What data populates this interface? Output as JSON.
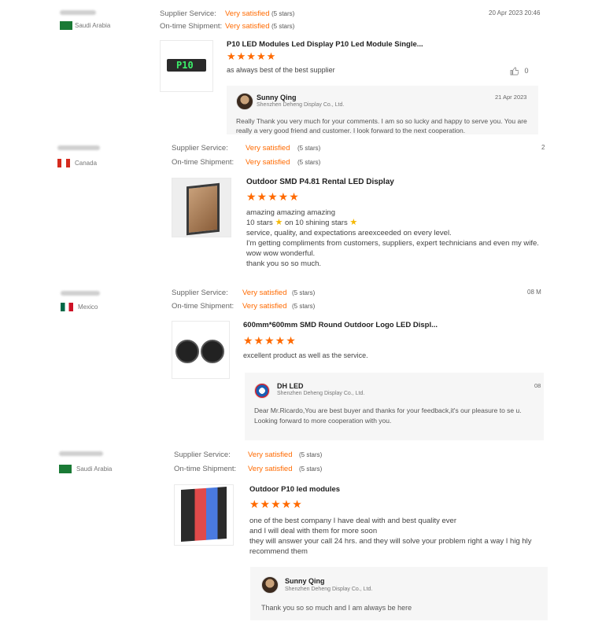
{
  "labels": {
    "supplier_service": "Supplier Service:",
    "ontime_shipment": "On-time Shipment:",
    "very_satisfied": "Very satisfied",
    "five_stars": "(5 stars)"
  },
  "colors": {
    "accent": "#ff6a00",
    "star_icon": "#f5b800"
  },
  "reviews": [
    {
      "country": "Saudi Arabia",
      "date": "20 Apr 2023 20:46",
      "product_title": "P10 LED Modules Led Display P10 Led Module Single...",
      "thumb_text": "P10",
      "rating_stars": 5,
      "text": [
        "as always best of the best supplier"
      ],
      "likes": "0",
      "reply": {
        "name": "Sunny Qing",
        "company": "Shenzhen Deheng Display Co., Ltd.",
        "date": "21 Apr 2023",
        "text": "Really Thank you very much for your comments. I am so so lucky and happy to serve you. You are really a very good friend and customer. I look forward to the next cooperation."
      }
    },
    {
      "country": "Canada",
      "date": "2",
      "product_title": "Outdoor SMD P4.81 Rental LED Display",
      "rating_stars": 5,
      "text": [
        "amazing amazing amazing",
        "10 stars",
        "on 10 shining stars",
        "service, quality, and expectations areexceeded on every level.",
        "I'm getting compliments from customers, suppliers, expert technicians and even my wife.",
        "wow wow wonderful.",
        "thank you so so much."
      ]
    },
    {
      "country": "Mexico",
      "date": "08 M",
      "product_title": "600mm*600mm SMD Round Outdoor Logo LED Displ...",
      "rating_stars": 5,
      "text": [
        "excellent product as well as the service."
      ],
      "reply": {
        "name": "DH LED",
        "company": "Shenzhen Deheng Display Co., Ltd.",
        "date": "08",
        "text": "Dear Mr.Ricardo,You are best buyer and thanks for your feedback,it's our pleasure to se u.",
        "text2": "Looking forward to more cooperation with you."
      }
    },
    {
      "country": "Saudi Arabia",
      "product_title": "Outdoor P10 led modules",
      "rating_stars": 5,
      "text": [
        "one of the best company I have deal with and best quality ever",
        "and I will deal with them for more soon",
        "they will answer your call 24 hrs. and they will solve your problem right a way I hig hly recommend them"
      ],
      "reply": {
        "name": "Sunny Qing",
        "company": "Shenzhen Deheng Display Co., Ltd.",
        "text": "Thank you so so much and I am always be here"
      }
    }
  ]
}
